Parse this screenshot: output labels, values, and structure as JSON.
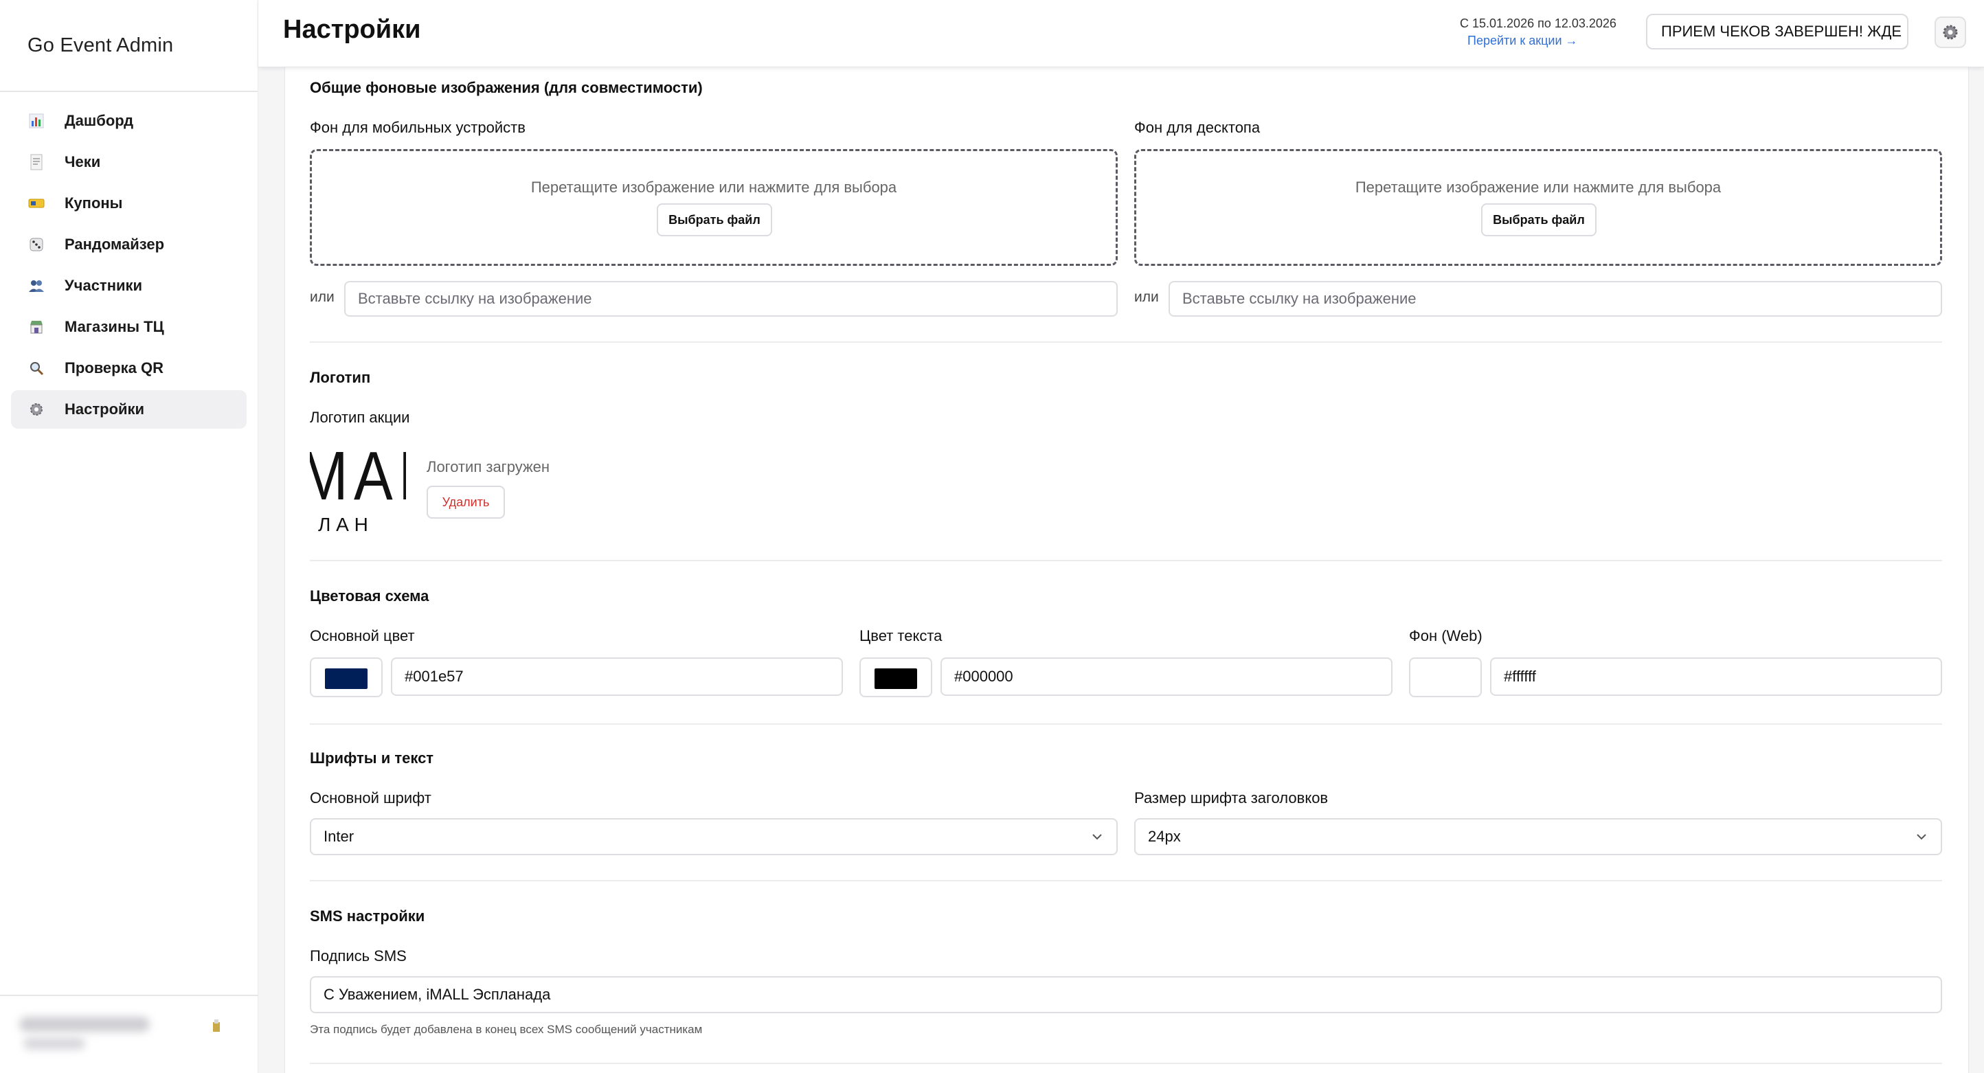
{
  "app": {
    "title": "Go Event Admin"
  },
  "sidebar": {
    "items": [
      {
        "label": "Дашборд",
        "icon": "bar-chart-icon",
        "active": false
      },
      {
        "label": "Чеки",
        "icon": "receipt-icon",
        "active": false
      },
      {
        "label": "Купоны",
        "icon": "ticket-icon",
        "active": false
      },
      {
        "label": "Рандомайзер",
        "icon": "dice-icon",
        "active": false
      },
      {
        "label": "Участники",
        "icon": "users-icon",
        "active": false
      },
      {
        "label": "Магазины ТЦ",
        "icon": "store-icon",
        "active": false
      },
      {
        "label": "Проверка QR",
        "icon": "magnifier-icon",
        "active": false
      },
      {
        "label": "Настройки",
        "icon": "gear-icon",
        "active": true
      }
    ]
  },
  "header": {
    "title": "Настройки",
    "period": "С 15.01.2026 по 12.03.2026",
    "period_link": "Перейти к акции →",
    "status_button": "ПРИЕМ ЧЕКОВ ЗАВЕРШЕН! ЖДЕ"
  },
  "backgrounds": {
    "section_title": "Общие фоновые изображения (для совместимости)",
    "mobile": {
      "label": "Фон для мобильных устройств",
      "drop_text": "Перетащите изображение или нажмите для выбора",
      "button": "Выбрать файл",
      "or": "или",
      "placeholder": "Вставьте ссылку на изображение"
    },
    "desktop": {
      "label": "Фон для десктопа",
      "drop_text": "Перетащите изображение или нажмите для выбора",
      "button": "Выбрать файл",
      "or": "или",
      "placeholder": "Вставьте ссылку на изображение"
    }
  },
  "logo": {
    "section_title": "Логотип",
    "label": "Логотип акции",
    "image_text_top": "MAL",
    "image_text_bottom": "Л А Н",
    "status": "Логотип загружен",
    "delete": "Удалить"
  },
  "colors": {
    "section_title": "Цветовая схема",
    "primary": {
      "label": "Основной цвет",
      "value": "#001e57"
    },
    "text": {
      "label": "Цвет текста",
      "value": "#000000"
    },
    "background": {
      "label": "Фон (Web)",
      "value": "#ffffff"
    }
  },
  "fonts": {
    "section_title": "Шрифты и текст",
    "main_font": {
      "label": "Основной шрифт",
      "value": "Inter"
    },
    "heading_size": {
      "label": "Размер шрифта заголовков",
      "value": "24px"
    }
  },
  "sms": {
    "section_title": "SMS настройки",
    "label": "Подпись SMS",
    "value": "С Уважением, iMALL Эспланада",
    "hint": "Эта подпись будет добавлена в конец всех SMS сообщений участникам"
  }
}
